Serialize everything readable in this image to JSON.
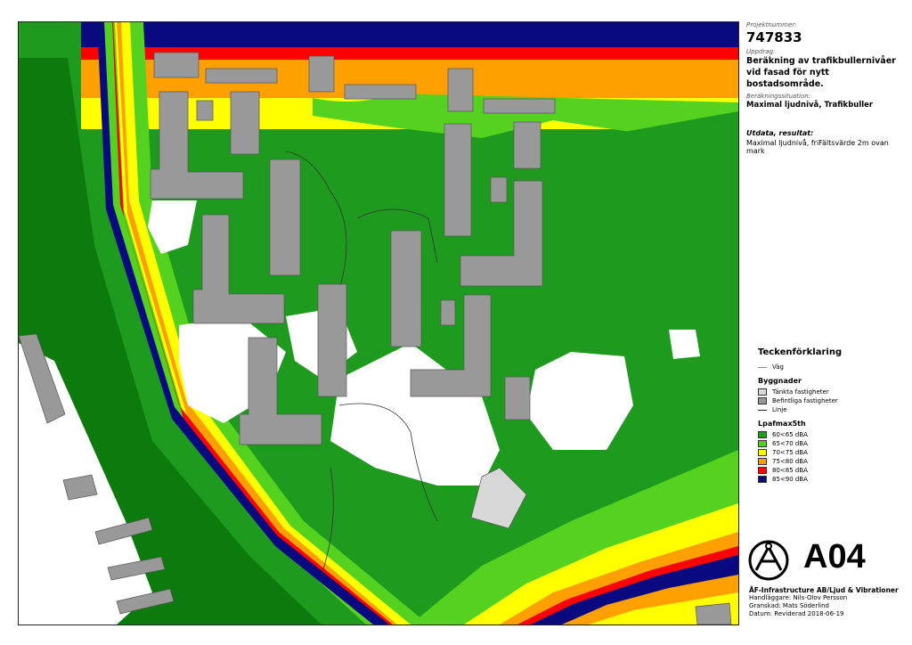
{
  "project": {
    "number_label": "Projektnummer:",
    "number": "747833",
    "assignment_label": "Uppdrag:",
    "assignment_line1": "Beräkning av trafikbullernivåer",
    "assignment_line2": "vid fasad för nytt bostadsområde.",
    "situation_label": "Beräkningssituation:",
    "situation": "Maximal ljudnivå,  Trafikbuller",
    "output_label": "Utdata, resultat:",
    "output": "Maximal ljudnivå, friFältsvärde 2m ovan mark"
  },
  "legend": {
    "title": "Teckenförklaring",
    "road": "Väg",
    "buildings_heading": "Byggnader",
    "planned": "Tänkta fastigheter",
    "existing": "Befintliga fastigheter",
    "line": "Linje",
    "noise_heading": "Lpafmax5th",
    "classes": [
      {
        "label": "60<65 dBA",
        "color": "#1e9b1e"
      },
      {
        "label": "65<70 dBA",
        "color": "#4fcf1f"
      },
      {
        "label": "70<75 dBA",
        "color": "#ffff00"
      },
      {
        "label": "75<80 dBA",
        "color": "#ffa000"
      },
      {
        "label": "80<85 dBA",
        "color": "#ff0000"
      },
      {
        "label": "85<90 dBA",
        "color": "#0a0a80"
      }
    ]
  },
  "colors": {
    "dark_green": "#0d7a0d",
    "green": "#2fb52a",
    "light_green": "#55d21f",
    "yellow": "#ffff00",
    "orange": "#ff9f00",
    "red": "#ff0000",
    "navy": "#0a0a80",
    "building": "#999999"
  },
  "drawing_code": "A04",
  "footer": {
    "company": "ÅF-Infrastructure AB/Ljud & Vibrationer",
    "handler": "Handläggare: Nils-Olov Persson",
    "reviewed": "Granskad: Mats Söderlind",
    "date": "Datum: Reviderad  2018-06-19"
  }
}
